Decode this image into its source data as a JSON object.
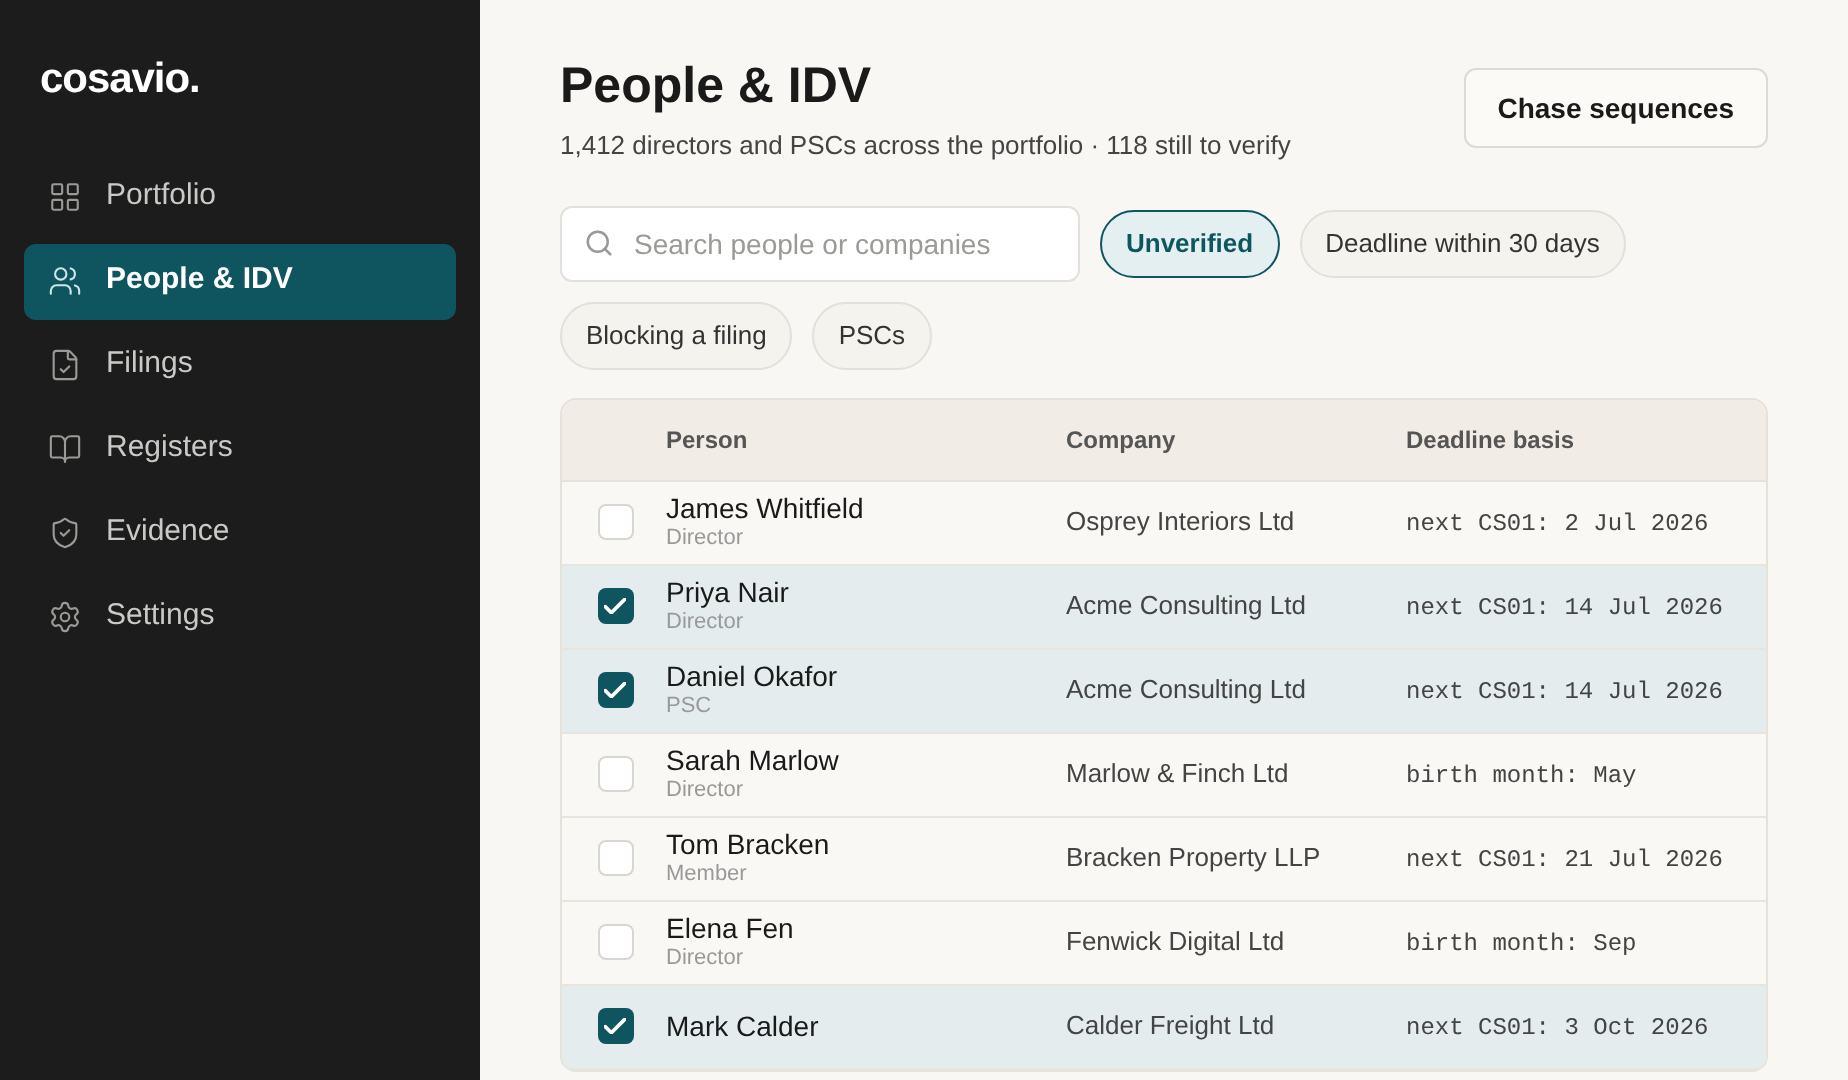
{
  "brand": "cosavio.",
  "sidebar": {
    "items": [
      {
        "label": "Portfolio",
        "selected": false
      },
      {
        "label": "People & IDV",
        "selected": true
      },
      {
        "label": "Filings",
        "selected": false
      },
      {
        "label": "Registers",
        "selected": false
      },
      {
        "label": "Evidence",
        "selected": false
      },
      {
        "label": "Settings",
        "selected": false
      }
    ]
  },
  "header": {
    "title": "People & IDV",
    "subtitle": "1,412 directors and PSCs across the portfolio · 118 still to verify",
    "button": "Chase sequences"
  },
  "search": {
    "placeholder": "Search people or companies"
  },
  "filters": [
    {
      "label": "Unverified",
      "selected": true
    },
    {
      "label": "Deadline within 30 days",
      "selected": false
    },
    {
      "label": "Blocking a filing",
      "selected": false
    },
    {
      "label": "PSCs",
      "selected": false
    }
  ],
  "table": {
    "columns": [
      "Person",
      "Company",
      "Deadline basis"
    ],
    "rows": [
      {
        "name": "James Whitfield",
        "role": "Director",
        "company": "Osprey Interiors Ltd",
        "deadline": "next CS01: 2 Jul 2026",
        "checked": false
      },
      {
        "name": "Priya Nair",
        "role": "Director",
        "company": "Acme Consulting Ltd",
        "deadline": "next CS01: 14 Jul 2026",
        "checked": true
      },
      {
        "name": "Daniel Okafor",
        "role": "PSC",
        "company": "Acme Consulting Ltd",
        "deadline": "next CS01: 14 Jul 2026",
        "checked": true
      },
      {
        "name": "Sarah Marlow",
        "role": "Director",
        "company": "Marlow & Finch Ltd",
        "deadline": "birth month: May",
        "checked": false
      },
      {
        "name": "Tom Bracken",
        "role": "Member",
        "company": "Bracken Property LLP",
        "deadline": "next CS01: 21 Jul 2026",
        "checked": false
      },
      {
        "name": "Elena Fen",
        "role": "Director",
        "company": "Fenwick Digital Ltd",
        "deadline": "birth month: Sep",
        "checked": false
      },
      {
        "name": "Mark Calder",
        "company": "Calder Freight Ltd",
        "deadline": "next CS01: 3 Oct 2026",
        "checked": true
      }
    ]
  }
}
